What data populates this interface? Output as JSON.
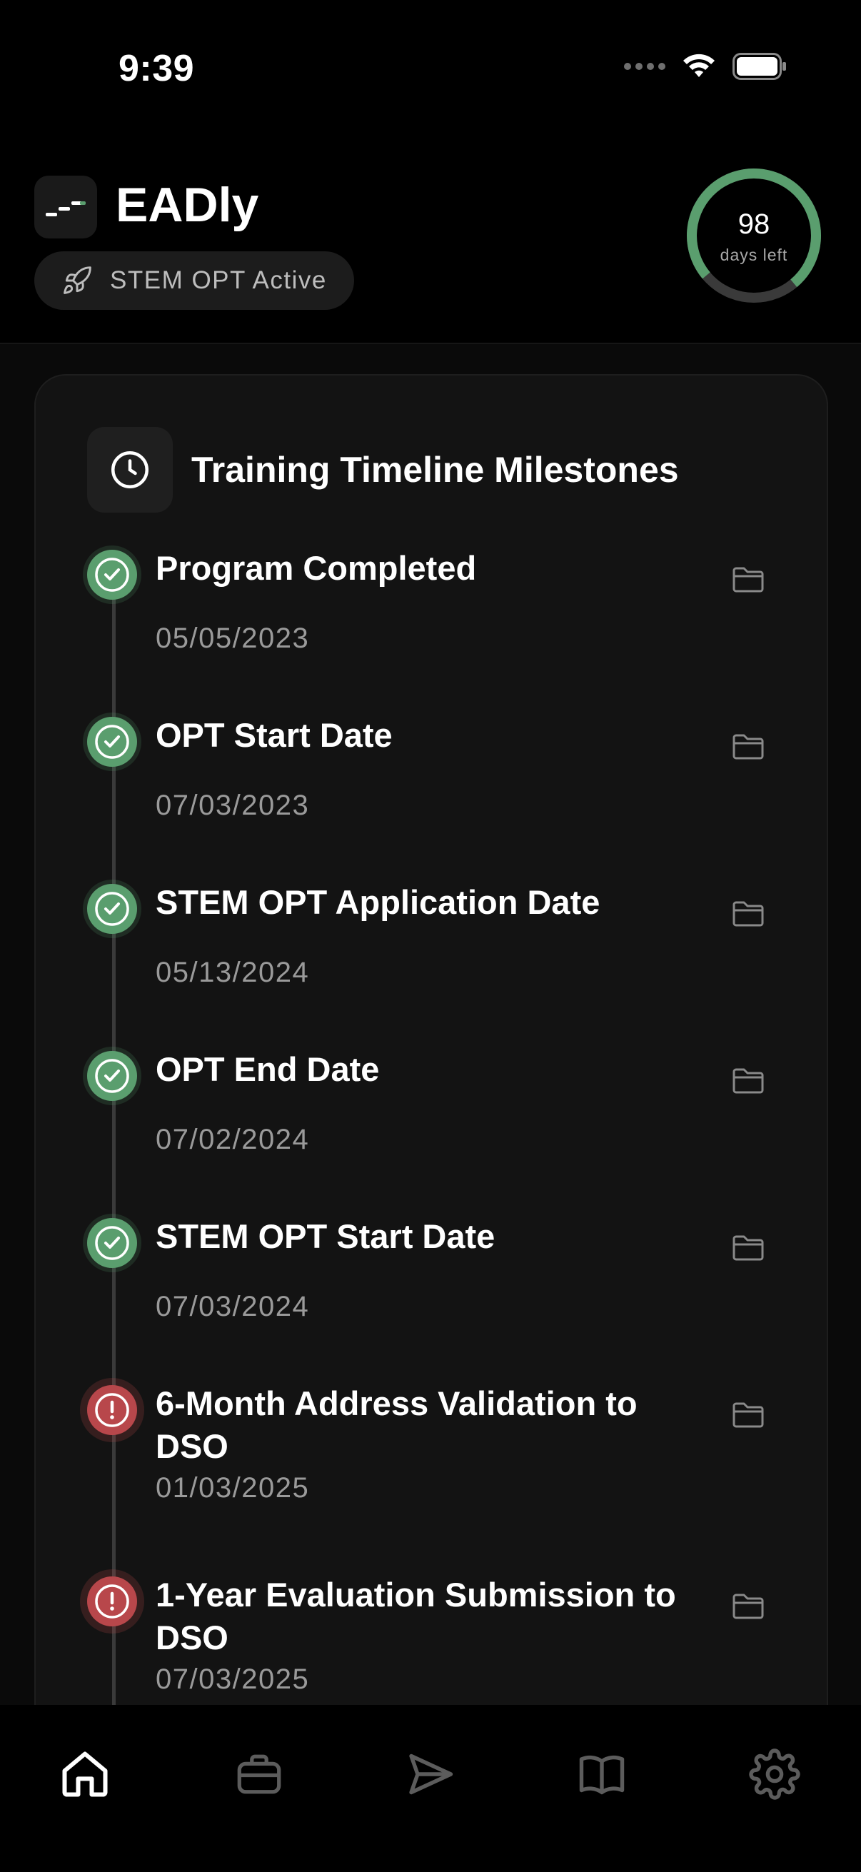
{
  "status_bar": {
    "time": "9:39"
  },
  "header": {
    "app_name": "EADly",
    "status_pill": "STEM OPT Active",
    "days_remaining": {
      "number": "98",
      "caption": "days left"
    }
  },
  "timeline": {
    "title": "Training Timeline Milestones",
    "milestones": [
      {
        "title": "Program Completed",
        "date": "05/05/2023",
        "status": "completed"
      },
      {
        "title": "OPT Start Date",
        "date": "07/03/2023",
        "status": "completed"
      },
      {
        "title": "STEM OPT Application Date",
        "date": "05/13/2024",
        "status": "completed"
      },
      {
        "title": "OPT End Date",
        "date": "07/02/2024",
        "status": "completed"
      },
      {
        "title": "STEM OPT Start Date",
        "date": "07/03/2024",
        "status": "completed"
      },
      {
        "title": "6-Month Address Validation to DSO",
        "date": "01/03/2025",
        "status": "overdue"
      },
      {
        "title": "1-Year Evaluation Submission to DSO",
        "date": "07/03/2025",
        "status": "overdue"
      }
    ]
  },
  "tab_bar": {
    "tabs": [
      {
        "icon": "home-icon",
        "active": true
      },
      {
        "icon": "briefcase-icon",
        "active": false
      },
      {
        "icon": "send-icon",
        "active": false
      },
      {
        "icon": "book-icon",
        "active": false
      },
      {
        "icon": "gear-icon",
        "active": false
      }
    ]
  },
  "colors": {
    "success": "#5a9e6e",
    "danger": "#b8474b",
    "card_bg": "#131313",
    "ring_track": "#3a3a3a"
  }
}
